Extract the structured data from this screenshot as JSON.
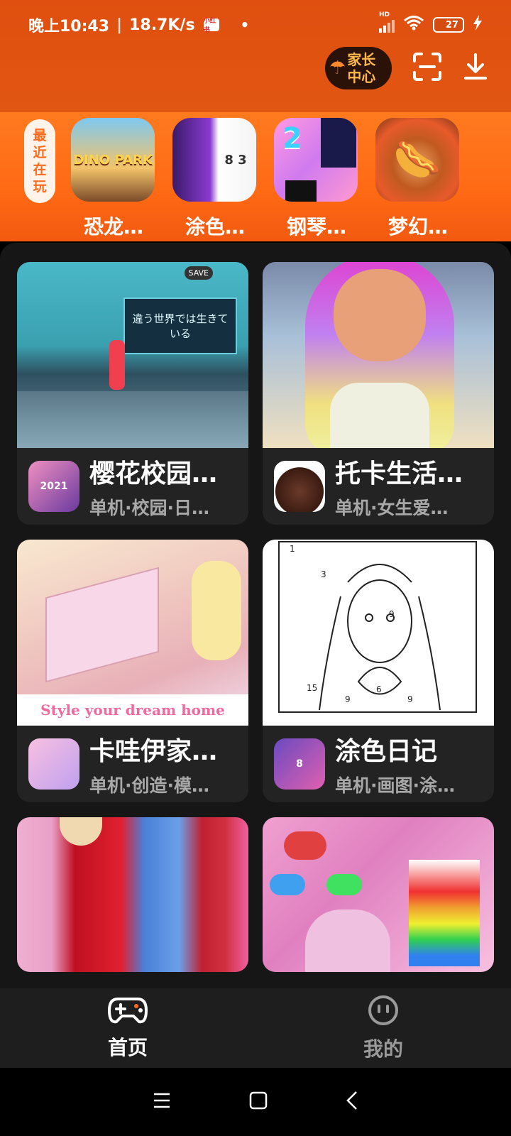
{
  "status_bar": {
    "time": "晚上10:43",
    "network_speed": "18.7K/s",
    "separator": "|",
    "notification_badge": "小红书",
    "dot": "•",
    "signal_label": "HD",
    "battery_level": "27",
    "battery_fraction": 0.27
  },
  "header": {
    "parent_center_label_line1": "家长",
    "parent_center_label_line2": "中心",
    "scan_icon": "scan-icon",
    "download_icon": "download-icon"
  },
  "recent": {
    "label_chars": [
      "最",
      "近",
      "在",
      "玩"
    ],
    "games": [
      {
        "name": "恐龙…",
        "icon_text": "DINO PARK"
      },
      {
        "name": "涂色…",
        "icon_text": "8 3"
      },
      {
        "name": "钢琴…",
        "icon_text": "2"
      },
      {
        "name": "梦幻…",
        "icon_text": "🌭"
      }
    ]
  },
  "cards": [
    {
      "title": "樱花校园…",
      "tags": "单机·校园·日…",
      "icon_text": "2021",
      "thumb_text": "違う世界では生きている",
      "thumb_sub": "SAVE"
    },
    {
      "title": "托卡生活…",
      "tags": "单机·女生爱…",
      "icon_text": ""
    },
    {
      "title": "卡哇伊家…",
      "tags": "单机·创造·模…",
      "icon_text": "",
      "thumb_text": "Style your dream home"
    },
    {
      "title": "涂色日记",
      "tags": "单机·画图·涂…",
      "icon_text": "8",
      "thumb_numbers": [
        "1",
        "3",
        "9",
        "6",
        "9",
        "9",
        "15"
      ]
    },
    {
      "title": "",
      "tags": ""
    },
    {
      "title": "",
      "tags": ""
    }
  ],
  "bottom_nav": {
    "home": "首页",
    "mine": "我的"
  },
  "colors": {
    "header_orange": "#e04f0f",
    "accent": "#ff6a1a",
    "panel_bg": "#161616",
    "card_bg": "#232323"
  }
}
